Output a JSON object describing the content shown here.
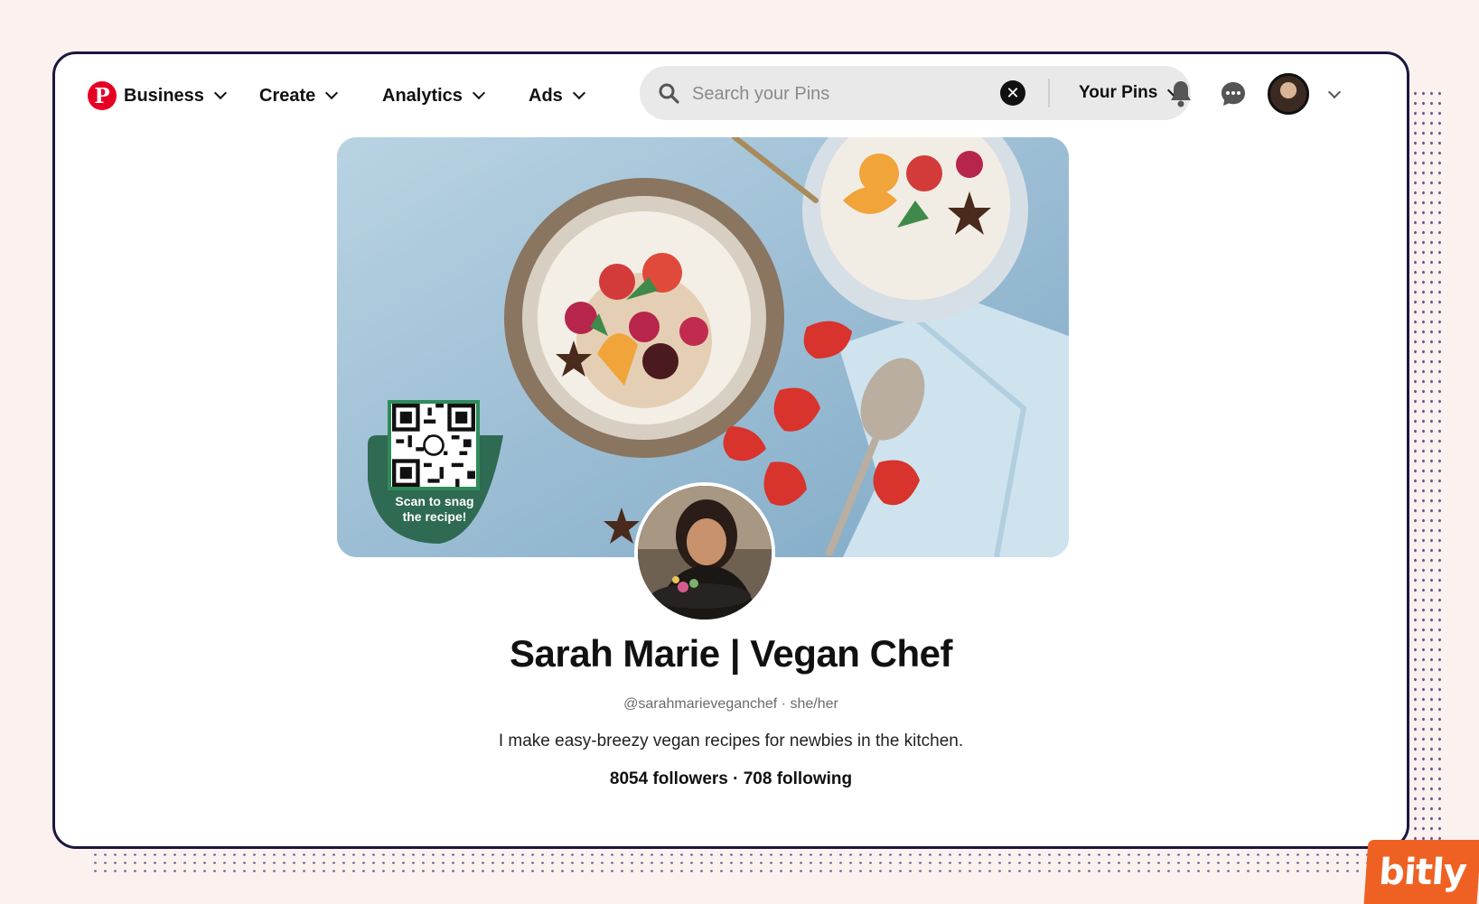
{
  "nav": {
    "business_label": "Business",
    "create_label": "Create",
    "analytics_label": "Analytics",
    "ads_label": "Ads",
    "search": {
      "value": "",
      "placeholder": "Search your Pins",
      "scope_label": "Your Pins"
    }
  },
  "cover": {
    "qr_caption_line1": "Scan to snag",
    "qr_caption_line2": "the recipe!"
  },
  "profile": {
    "name": "Sarah Marie | Vegan Chef",
    "handle": "@sarahmarieveganchef · she/her",
    "bio": "I make easy-breezy vegan recipes for newbies in the kitchen.",
    "stats": "8054 followers · 708 following"
  },
  "brand": {
    "logo_text": "bitly",
    "accent": "#ee6123",
    "pinterest_red": "#e60023"
  },
  "icons": [
    "pinterest-logo-icon",
    "chevron-down-icon",
    "search-icon",
    "clear-icon",
    "bell-icon",
    "messages-icon",
    "avatar"
  ]
}
